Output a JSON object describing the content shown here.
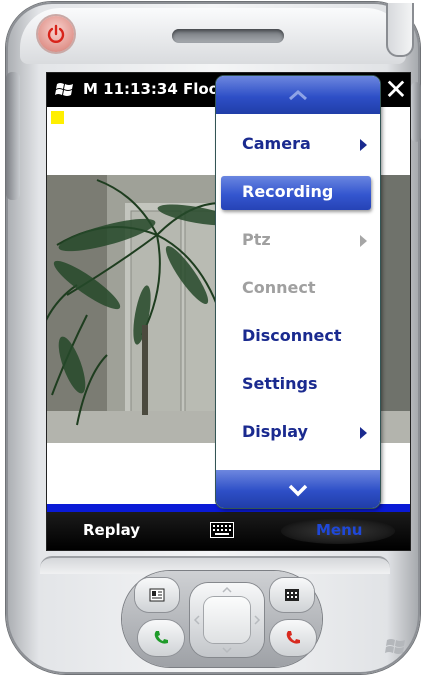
{
  "status_bar": {
    "title": "M 11:13:34 Floo",
    "close_label": "✕"
  },
  "menu": {
    "items": [
      {
        "label": "Camera",
        "submenu": true,
        "enabled": true,
        "selected": false
      },
      {
        "label": "Recording",
        "submenu": false,
        "enabled": true,
        "selected": true
      },
      {
        "label": "Ptz",
        "submenu": true,
        "enabled": false,
        "selected": false
      },
      {
        "label": "Connect",
        "submenu": false,
        "enabled": false,
        "selected": false
      },
      {
        "label": "Disconnect",
        "submenu": false,
        "enabled": true,
        "selected": false
      },
      {
        "label": "Settings",
        "submenu": false,
        "enabled": true,
        "selected": false
      },
      {
        "label": "Display",
        "submenu": true,
        "enabled": true,
        "selected": false
      }
    ]
  },
  "softkeys": {
    "left": "Replay",
    "right": "Menu"
  },
  "colors": {
    "menu_text": "#1a2a8f",
    "menu_highlight": "#3456cf",
    "status_bar": "#000000",
    "blue_strip": "#0a1ad6",
    "indicator": "#ffef00"
  },
  "icons": [
    "power-icon",
    "windows-flag-icon",
    "close-icon",
    "chevron-up-icon",
    "chevron-down-icon",
    "keyboard-icon",
    "contacts-icon",
    "calendar-icon",
    "call-icon",
    "end-call-icon"
  ]
}
